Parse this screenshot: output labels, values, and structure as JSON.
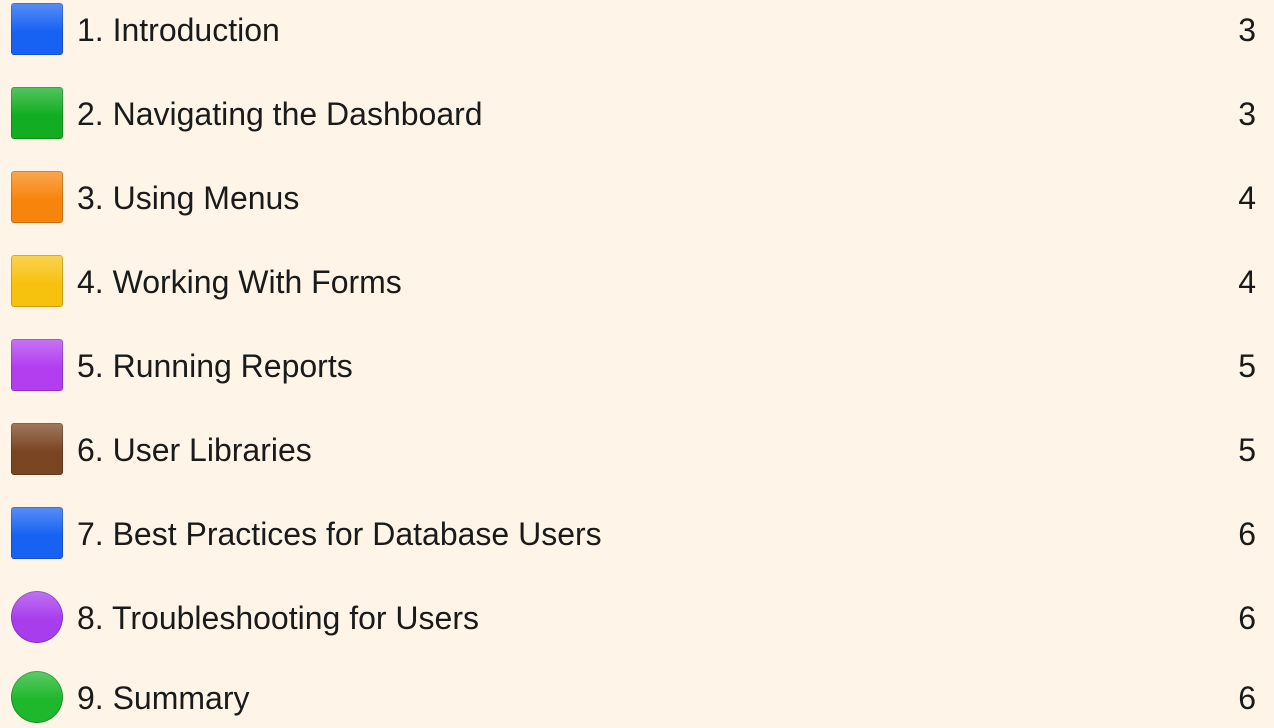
{
  "toc": {
    "items": [
      {
        "title": "1. Introduction",
        "page": "3",
        "icon": "blue-square-icon",
        "color": "#1762f2",
        "shape": "square"
      },
      {
        "title": "2. Navigating the Dashboard",
        "page": "3",
        "icon": "green-square-icon",
        "color": "#12ad22",
        "shape": "square"
      },
      {
        "title": "3. Using Menus",
        "page": "4",
        "icon": "orange-square-icon",
        "color": "#f7850c",
        "shape": "square"
      },
      {
        "title": "4. Working With Forms",
        "page": "4",
        "icon": "yellow-square-icon",
        "color": "#f7c20e",
        "shape": "square"
      },
      {
        "title": "5. Running Reports",
        "page": "5",
        "icon": "purple-square-icon",
        "color": "#b23ef0",
        "shape": "square"
      },
      {
        "title": "6. User Libraries",
        "page": "5",
        "icon": "brown-square-icon",
        "color": "#7a4522",
        "shape": "square"
      },
      {
        "title": "7. Best Practices for Database Users",
        "page": "6",
        "icon": "blue-square-icon",
        "color": "#1762f2",
        "shape": "square"
      },
      {
        "title": "8. Troubleshooting for Users",
        "page": "6",
        "icon": "purple-circle-icon",
        "color": "#a83ded",
        "shape": "circle"
      },
      {
        "title": "9. Summary",
        "page": "6",
        "icon": "green-circle-icon",
        "color": "#1fb72c",
        "shape": "circle"
      }
    ]
  }
}
